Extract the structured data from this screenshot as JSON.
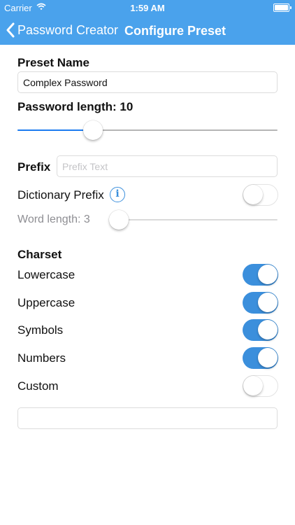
{
  "status_bar": {
    "carrier": "Carrier",
    "time": "1:59 AM"
  },
  "nav": {
    "back_label": "Password Creator",
    "title": "Configure Preset"
  },
  "preset": {
    "name_label": "Preset Name",
    "name_value": "Complex Password"
  },
  "password_length": {
    "label": "Password length: 10",
    "value": 10,
    "slider_fraction": 0.29
  },
  "prefix": {
    "label": "Prefix",
    "placeholder": "Prefix Text",
    "value": ""
  },
  "dictionary_prefix": {
    "label": "Dictionary Prefix",
    "enabled": false
  },
  "word_length": {
    "label": "Word length: 3",
    "value": 3,
    "slider_fraction": 0.0
  },
  "charset": {
    "header": "Charset",
    "options": [
      {
        "label": "Lowercase",
        "enabled": true
      },
      {
        "label": "Uppercase",
        "enabled": true
      },
      {
        "label": "Symbols",
        "enabled": true
      },
      {
        "label": "Numbers",
        "enabled": true
      },
      {
        "label": "Custom",
        "enabled": false
      }
    ],
    "custom_value": ""
  },
  "colors": {
    "nav_background": "#4aa2ec",
    "accent": "#3b8fdc",
    "slider_fill": "#1c7bf0"
  }
}
